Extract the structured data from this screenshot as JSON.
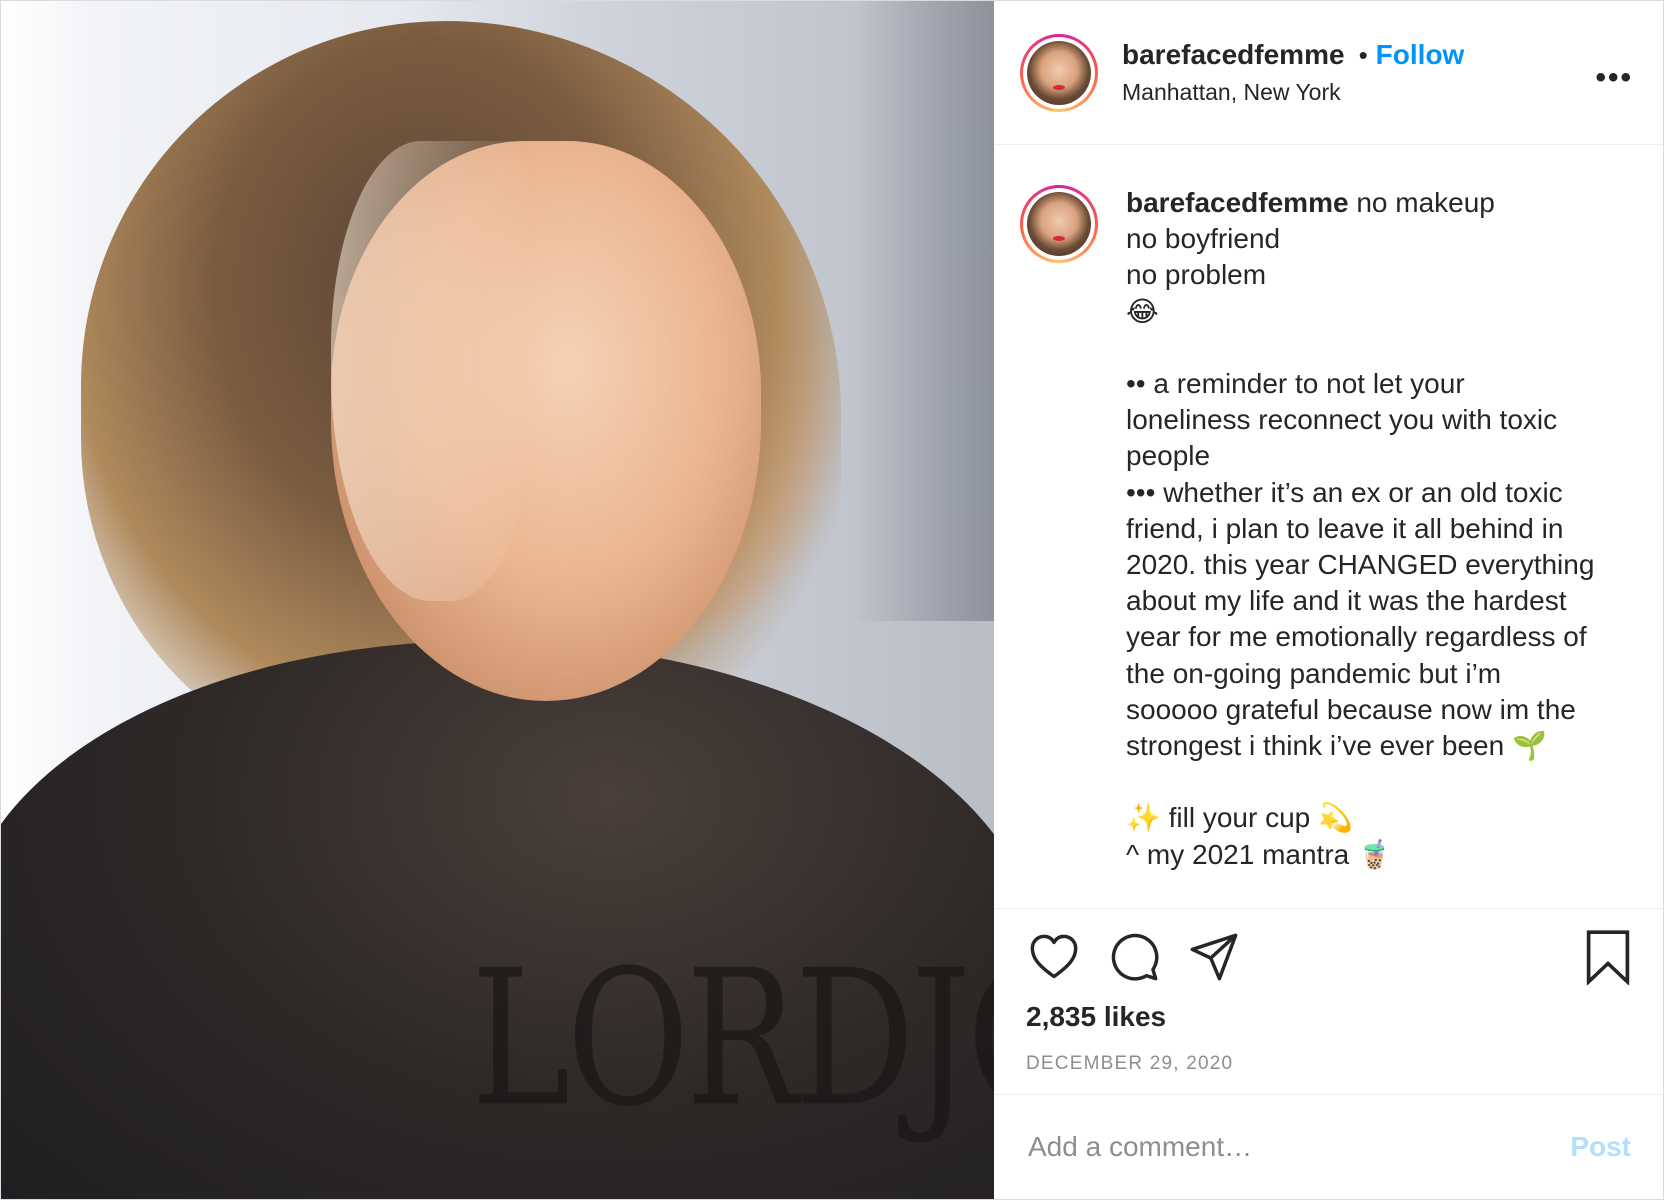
{
  "photo": {
    "sweater_text": "LORDJONES"
  },
  "header": {
    "username": "barefacedfemme",
    "separator": "•",
    "follow_label": "Follow",
    "location": "Manhattan, New York",
    "more_label": "•••",
    "avatar_icon": "profile-avatar"
  },
  "caption": {
    "username": "barefacedfemme",
    "first_line_text": " no makeup",
    "lines": [
      "no boyfriend",
      "no problem",
      "😂",
      "",
      "•• a reminder to not let your",
      "loneliness reconnect you with toxic",
      "people",
      "••• whether it’s an ex or an old toxic",
      "friend, i plan to leave it all behind in",
      "2020. this year CHANGED everything",
      "about my life and it was the hardest",
      "year for me emotionally regardless of",
      "the on-going pandemic but i’m",
      "sooooo grateful because now im the",
      "strongest i think i’ve ever been 🌱",
      "",
      "✨ fill your cup 💫",
      "^ my 2021 mantra 🧋"
    ]
  },
  "actions": {
    "icons": [
      "heart-icon",
      "comment-icon",
      "share-icon",
      "bookmark-icon"
    ],
    "likes": "2,835 likes",
    "date": "DECEMBER 29, 2020"
  },
  "comment": {
    "placeholder": "Add a comment…",
    "post_label": "Post"
  },
  "colors": {
    "follow": "#0095f6",
    "post_disabled": "#b2dffc",
    "text": "#262626",
    "muted": "#8e8e8e",
    "border": "#dbdbdb"
  }
}
